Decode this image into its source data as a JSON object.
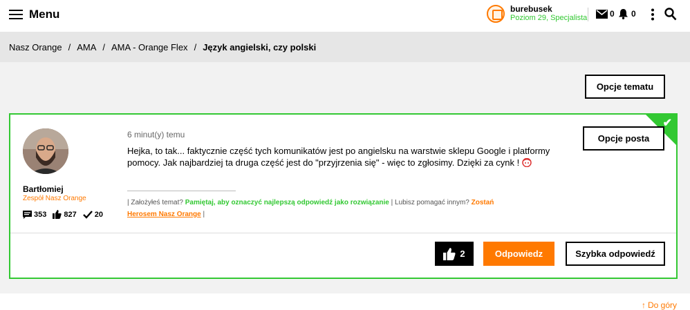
{
  "header": {
    "menu_label": "Menu",
    "user": {
      "name": "burebusek",
      "level": "Poziom 29, Specjalista"
    },
    "mail_count": "0",
    "notification_count": "0"
  },
  "breadcrumb": {
    "items": [
      "Nasz Orange",
      "AMA",
      "AMA - Orange Flex"
    ],
    "separator": "/",
    "current": "Język angielski, czy polski"
  },
  "topic_options_label": "Opcje tematu",
  "post": {
    "author": {
      "name": "Bartłomiej",
      "role": "Zespół Nasz Orange"
    },
    "stats": {
      "posts": "353",
      "likes": "827",
      "solutions": "20"
    },
    "time": "6 minut(y) temu",
    "body": "Hejka, to tak... faktycznie część tych komunikatów jest po angielsku na warstwie sklepu Google i platformy pomocy. Jak najbardziej ta druga część jest do \"przyjrzenia się\" - więc to zgłosimy. Dzięki za cynk !",
    "footer_note": {
      "part1": "| Założyłeś temat?",
      "link1": "Pamiętaj, aby oznaczyć najlepszą odpowiedź jako rozwiązanie",
      "part2": "| Lubisz pomagać innym?",
      "link2": "Zostań",
      "link3": "Herosem Nasz Orange",
      "part3": "|"
    },
    "options_label": "Opcje posta",
    "likes": "2",
    "reply_label": "Odpowiedz",
    "quick_reply_label": "Szybka odpowiedź"
  },
  "to_top_label": "Do góry",
  "colors": {
    "accent": "#ff7900",
    "success": "#32c832"
  },
  "icons": [
    "hamburger-icon",
    "user-avatar-icon",
    "mail-icon",
    "bell-icon",
    "more-vertical-icon",
    "search-icon",
    "accepted-check-icon",
    "messages-icon",
    "thumbs-up-icon",
    "checkmark-icon",
    "emoji-icon",
    "arrow-up-icon"
  ]
}
